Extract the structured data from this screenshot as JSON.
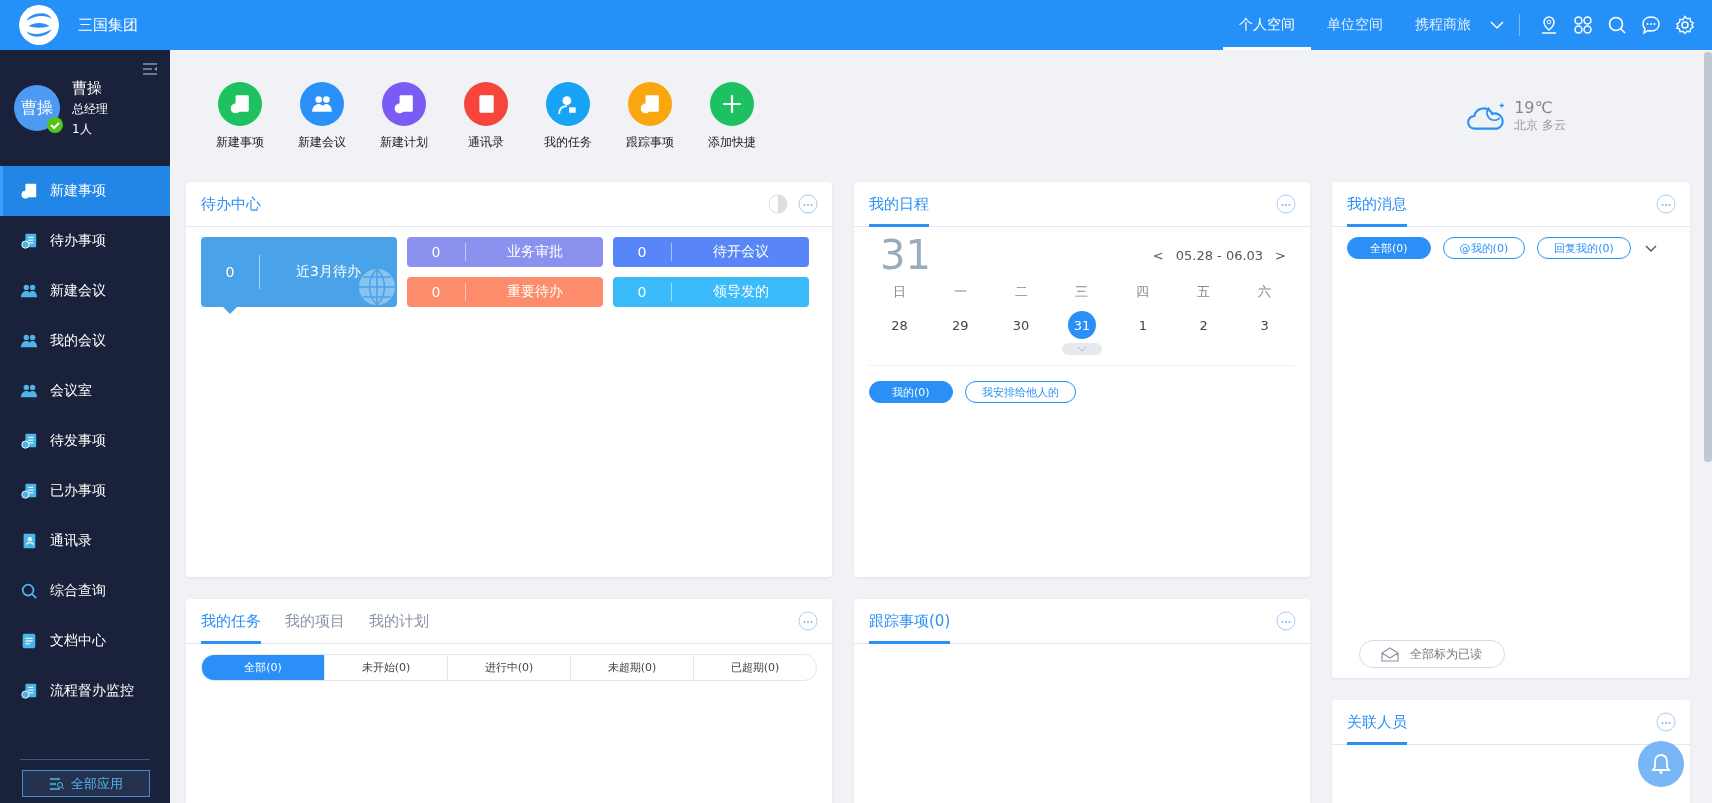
{
  "header": {
    "logo_text": "三国集团",
    "nav_tabs": [
      {
        "label": "个人空间",
        "selected": true
      },
      {
        "label": "单位空间",
        "selected": false
      },
      {
        "label": "携程商旅",
        "selected": false
      }
    ]
  },
  "sidebar": {
    "user": {
      "avatar_text": "曹操",
      "name": "曹操",
      "title": "总经理",
      "count": "1人",
      "online": true
    },
    "items": [
      {
        "label": "新建事项",
        "kind": "doc",
        "selected": true
      },
      {
        "label": "待办事项",
        "kind": "doc",
        "selected": false
      },
      {
        "label": "新建会议",
        "kind": "people",
        "selected": false
      },
      {
        "label": "我的会议",
        "kind": "people",
        "selected": false
      },
      {
        "label": "会议室",
        "kind": "people",
        "selected": false
      },
      {
        "label": "待发事项",
        "kind": "doc",
        "selected": false
      },
      {
        "label": "已办事项",
        "kind": "doc",
        "selected": false
      },
      {
        "label": "通讯录",
        "kind": "book",
        "selected": false
      },
      {
        "label": "综合查询",
        "kind": "search",
        "selected": false
      },
      {
        "label": "文档中心",
        "kind": "note",
        "selected": false
      },
      {
        "label": "流程督办监控",
        "kind": "doc",
        "selected": false
      }
    ],
    "all_apps": "全部应用"
  },
  "quick_actions": [
    {
      "label": "新建事项",
      "kind": "doc",
      "color": "#1ec15f"
    },
    {
      "label": "新建会议",
      "kind": "people",
      "color": "#2a8ff7"
    },
    {
      "label": "新建计划",
      "kind": "doc",
      "color": "#7a5cf5"
    },
    {
      "label": "通讯录",
      "kind": "book",
      "color": "#f5453d"
    },
    {
      "label": "我的任务",
      "kind": "person",
      "color": "#19a3f5"
    },
    {
      "label": "跟踪事项",
      "kind": "doc",
      "color": "#f9a60f"
    },
    {
      "label": "添加快捷",
      "kind": "plus",
      "color": "#1ec15f"
    }
  ],
  "weather": {
    "temperature": "19℃",
    "description": "北京 多云"
  },
  "todo_center": {
    "title": "待办中心",
    "stats": [
      {
        "count": "0",
        "label": "近3月待办",
        "color": "#4aa3e8",
        "kind": "main"
      },
      {
        "count": "0",
        "label": "业务审批",
        "color": "#8a91ef",
        "kind": "small"
      },
      {
        "count": "0",
        "label": "待开会议",
        "color": "#5886f8",
        "kind": "small"
      },
      {
        "count": "0",
        "label": "重要待办",
        "color": "#fd8c6c",
        "kind": "small"
      },
      {
        "count": "0",
        "label": "领导发的",
        "color": "#3bbbfa",
        "kind": "small"
      }
    ]
  },
  "tasks": {
    "tabs": [
      {
        "label": "我的任务",
        "selected": true
      },
      {
        "label": "我的项目",
        "selected": false
      },
      {
        "label": "我的计划",
        "selected": false
      }
    ],
    "filters": [
      {
        "label": "全部(0)",
        "selected": true
      },
      {
        "label": "未开始(0)",
        "selected": false
      },
      {
        "label": "进行中(0)",
        "selected": false
      },
      {
        "label": "未超期(0)",
        "selected": false
      },
      {
        "label": "已超期(0)",
        "selected": false
      }
    ]
  },
  "schedule": {
    "title": "我的日程",
    "big_day": "31",
    "prev": "<",
    "range": "05.28 - 06.03",
    "next": ">",
    "weekdays": [
      "日",
      "一",
      "二",
      "三",
      "四",
      "五",
      "六"
    ],
    "days": [
      {
        "label": "28",
        "selected": false
      },
      {
        "label": "29",
        "selected": false
      },
      {
        "label": "30",
        "selected": false
      },
      {
        "label": "31",
        "selected": true
      },
      {
        "label": "1",
        "selected": false
      },
      {
        "label": "2",
        "selected": false
      },
      {
        "label": "3",
        "selected": false
      }
    ],
    "filters": [
      {
        "label": "我的(0)",
        "selected": true
      },
      {
        "label": "我安排给他人的",
        "selected": false
      }
    ]
  },
  "tracking": {
    "title": "跟踪事项(0)"
  },
  "messages": {
    "title": "我的消息",
    "filters": [
      {
        "label": "全部(0)",
        "selected": true
      },
      {
        "label": "@我的(0)",
        "selected": false
      },
      {
        "label": "回复我的(0)",
        "selected": false
      }
    ],
    "mark_all_read": "全部标为已读"
  },
  "related": {
    "title": "关联人员"
  }
}
